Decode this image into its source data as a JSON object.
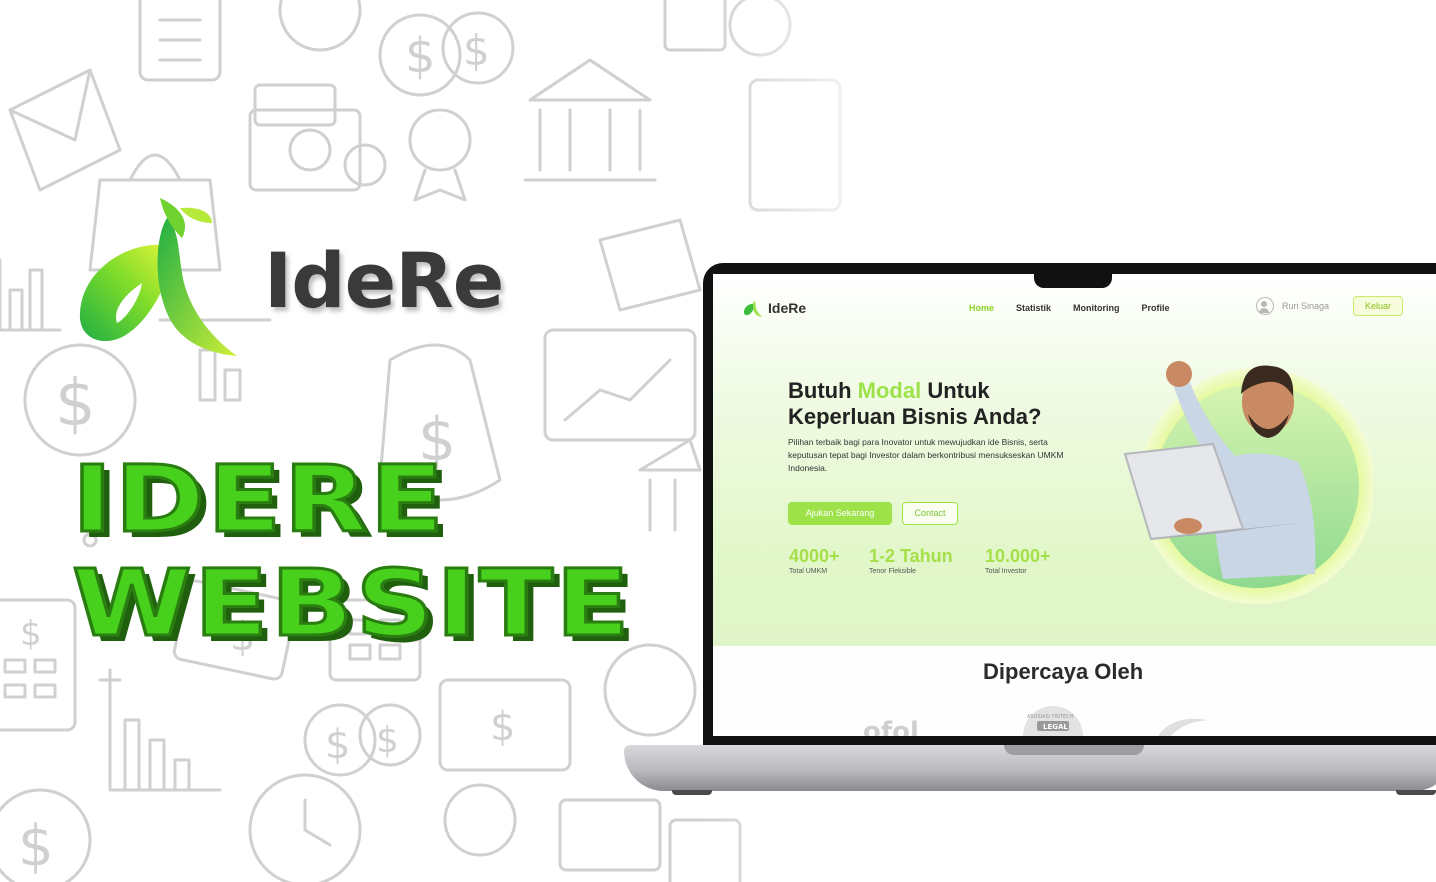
{
  "brand": {
    "name": "IdeRe",
    "headline_line1": "IDERE",
    "headline_line2": "WEBSITE"
  },
  "colors": {
    "accent_green": "#47d11c",
    "site_accent": "#9ee24a",
    "text_dark": "#222222"
  },
  "site": {
    "nav": {
      "logo_text": "IdeRe",
      "links": [
        "Home",
        "Statistik",
        "Monitoring",
        "Profile"
      ],
      "active": "Home",
      "user_name": "Ruri Sinaga",
      "logout_label": "Keluar"
    },
    "hero": {
      "title_part1": "Butuh ",
      "title_accent": "Modal",
      "title_part2": " Untuk",
      "title_line2": "Keperluan Bisnis Anda?",
      "description": "Pilihan terbaik bagi para Inovator untuk mewujudkan ide Bisnis, serta keputusan tepat bagi Investor dalam berkontribusi mensukseskan UMKM Indonesia.",
      "primary_cta": "Ajukan Sekarang",
      "secondary_cta": "Contact",
      "stats": [
        {
          "value": "4000+",
          "label": "Total UMKM"
        },
        {
          "value": "1-2 Tahun",
          "label": "Tenor Fleksible"
        },
        {
          "value": "10.000+",
          "label": "Total Investor"
        }
      ]
    },
    "trusted": {
      "title": "Dipercaya Oleh",
      "partner_badge_lines": [
        "ASOSIASI FINTECH",
        "LEGAL"
      ]
    }
  },
  "icons": [
    "idere-logo-icon",
    "user-avatar-icon",
    "money-doodle-pattern"
  ]
}
